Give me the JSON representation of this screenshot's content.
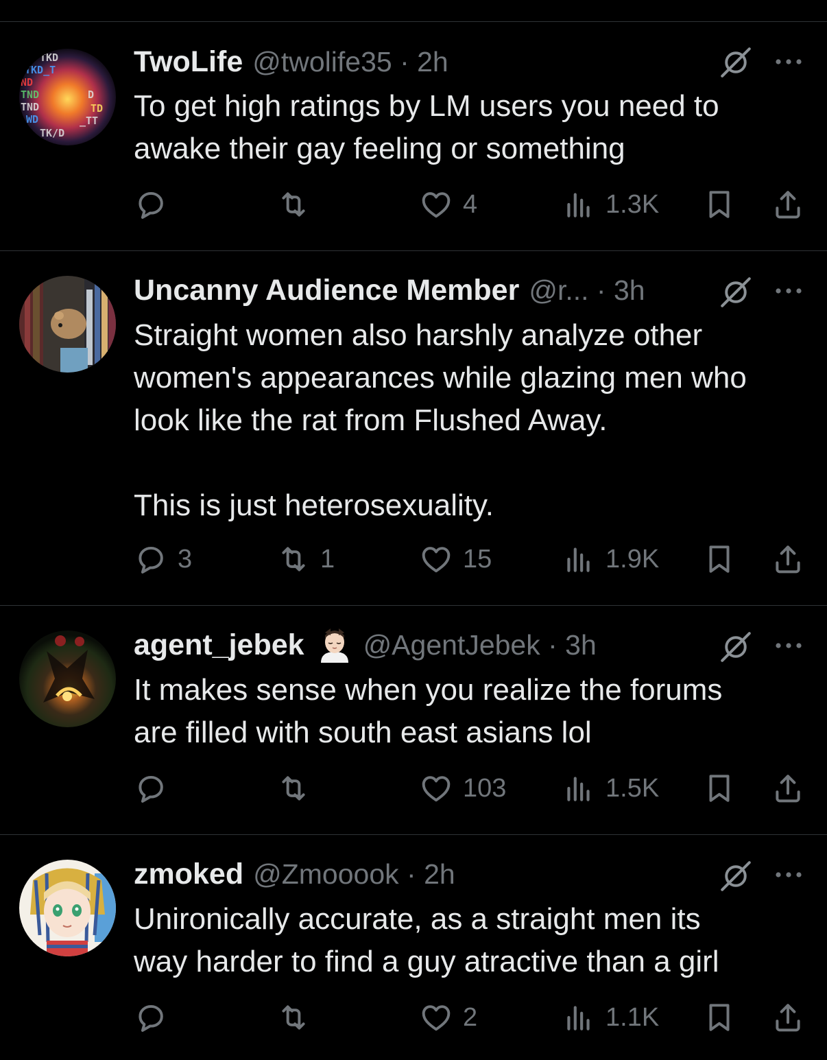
{
  "colors": {
    "background": "#000000",
    "text_primary": "#e7e9ea",
    "text_secondary": "#71767b",
    "divider": "#2f3336"
  },
  "icons": {
    "reply": "reply-icon",
    "retweet": "retweet-icon",
    "like": "heart-icon",
    "views": "views-chart-icon",
    "bookmark": "bookmark-icon",
    "share": "share-icon",
    "grok": "grok-icon",
    "more": "more-dots-icon"
  },
  "tweets": [
    {
      "display_name": "TwoLife",
      "handle_time": "@twolife35 · 2h",
      "text": "To get high ratings by LM users you need to\nawake their gay feeling or something",
      "replies": "",
      "retweets": "",
      "likes": "4",
      "views": "1.3K"
    },
    {
      "display_name": "Uncanny Audience Member",
      "handle_time": "@r... · 3h",
      "text": "Straight women also harshly analyze other\nwomen's appearances while glazing men who\nlook like the rat from Flushed Away.\n\nThis is just heterosexuality.",
      "replies": "3",
      "retweets": "1",
      "likes": "15",
      "views": "1.9K"
    },
    {
      "display_name": "agent_jebek",
      "handle_time": "@AgentJebek · 3h",
      "text": "It makes sense when you realize the forums\nare filled with south east asians lol",
      "replies": "",
      "retweets": "",
      "likes": "103",
      "views": "1.5K"
    },
    {
      "display_name": "zmoked",
      "handle_time": "@Zmooook · 2h",
      "text": "Unironically accurate, as a straight men its\nway harder to find a guy atractive than a girl",
      "replies": "",
      "retweets": "",
      "likes": "2",
      "views": "1.1K"
    }
  ]
}
